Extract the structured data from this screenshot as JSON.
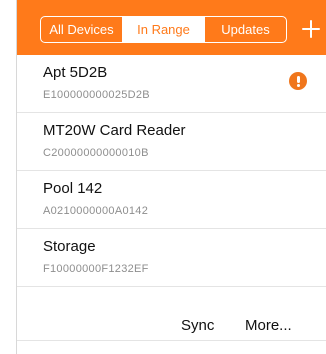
{
  "segments": [
    {
      "label": "All Devices",
      "selected": false
    },
    {
      "label": "In Range",
      "selected": true
    },
    {
      "label": "Updates",
      "selected": false
    }
  ],
  "devices": [
    {
      "name": "Apt 5D2B",
      "serial": "E100000000025D2B",
      "alert": true
    },
    {
      "name": "MT20W Card Reader",
      "serial": "C20000000000010B",
      "alert": false
    },
    {
      "name": "Pool 142",
      "serial": "A0210000000A0142",
      "alert": false
    },
    {
      "name": "Storage",
      "serial": "F10000000F1232EF",
      "alert": false
    }
  ],
  "toolbar": {
    "sync_label": "Sync",
    "more_label": "More..."
  },
  "icons": {
    "add": "plus-icon",
    "alert": "exclamation-circle-icon"
  },
  "colors": {
    "accent": "#ff7a1a",
    "alert": "#f0761c",
    "text_primary": "#111111",
    "text_secondary": "#8e8e8e"
  }
}
